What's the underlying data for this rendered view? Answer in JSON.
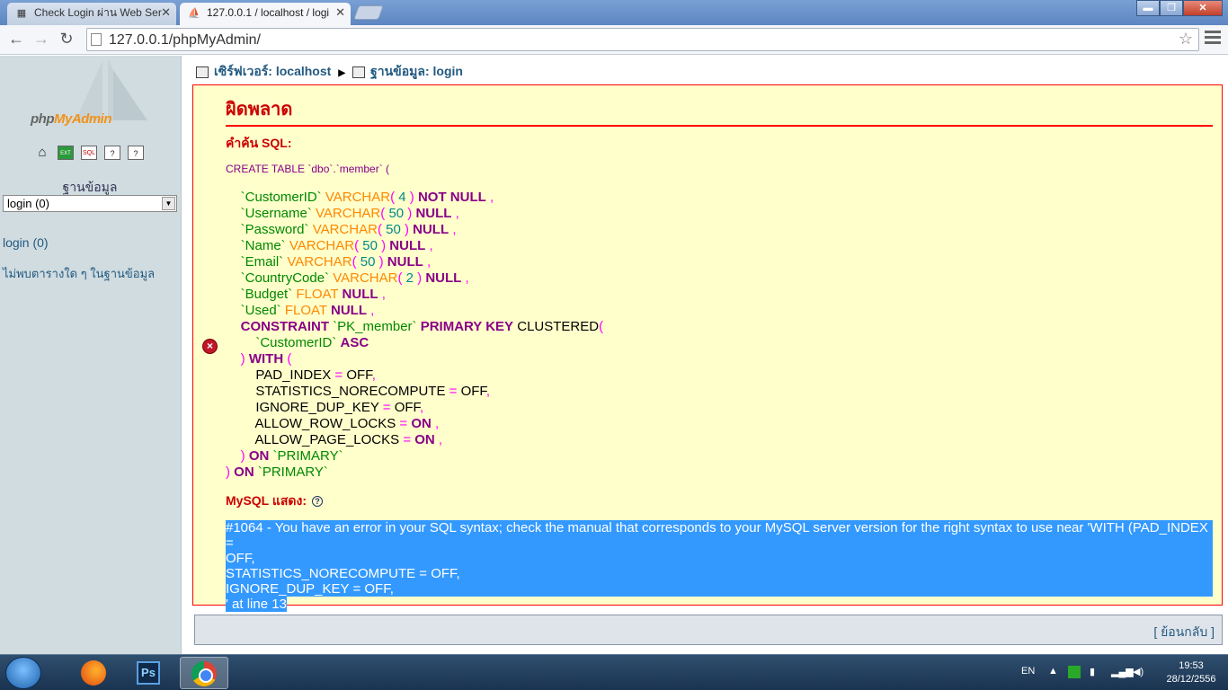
{
  "browser": {
    "tabs": [
      {
        "label": "Check Login ผ่าน Web Ser",
        "icon": "page-icon"
      },
      {
        "label": "127.0.0.1 / localhost / logi",
        "icon": "pma-icon"
      }
    ],
    "url": "127.0.0.1/phpMyAdmin/",
    "win_min": "▬",
    "win_max": "❐",
    "win_close": "✕"
  },
  "sidebar": {
    "logo_php": "php",
    "logo_my": "MyAdmin",
    "icons": [
      "home-icon",
      "exit-icon",
      "sql-icon",
      "docs-icon",
      "query-icon"
    ],
    "icon_glyphs": [
      "⌂",
      "EXT",
      "SQL",
      "?",
      "?"
    ],
    "db_label": "ฐานข้อมูล",
    "db_select": "login (0)",
    "db_link": "login (0)",
    "no_tables": "ไม่พบตารางใด ๆ ในฐานข้อมูล"
  },
  "breadcrumb": {
    "server": "เซิร์ฟเวอร์: localhost",
    "database": "ฐานข้อมูล: login"
  },
  "error": {
    "title": "ผิดพลาด",
    "sql_label": "คำค้น SQL:",
    "sql_first": "CREATE TABLE `dbo`.`member` (",
    "mysql_label": "MySQL แสดง:",
    "help": "?",
    "message_line1": "#1064 - You have an error in your SQL syntax; check the manual that corresponds to your MySQL server version for the right syntax to use near 'WITH (PAD_INDEX =",
    "message_line2": "OFF,",
    "message_line3": "STATISTICS_NORECOMPUTE = OFF,",
    "message_line4": "IGNORE_DUP_KEY = OFF,",
    "message_line5": "' at line 13"
  },
  "back": "[ ย้อนกลับ ]",
  "taskbar": {
    "lang": "EN",
    "time": "19:53",
    "date": "28/12/2556",
    "ps_label": "Ps"
  }
}
